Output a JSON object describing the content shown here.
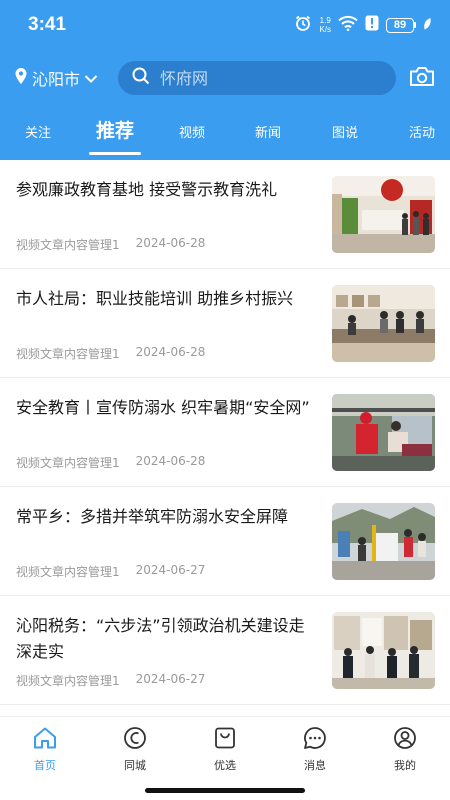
{
  "status_bar": {
    "time": "3:41",
    "net_speed_value": "1.9",
    "net_speed_unit": "K/s",
    "battery": "89",
    "icons": [
      "alarm-icon",
      "wifi-icon",
      "alert-icon",
      "battery-icon",
      "leaf-icon"
    ]
  },
  "header": {
    "city": "沁阳市",
    "search_placeholder": "怀府网",
    "camera_icon": "camera-icon",
    "background_color": "#3a9df0"
  },
  "tabs": [
    {
      "label": "关注"
    },
    {
      "label": "推荐",
      "active": true
    },
    {
      "label": "视频"
    },
    {
      "label": "新闻"
    },
    {
      "label": "图说"
    },
    {
      "label": "活动"
    }
  ],
  "articles": [
    {
      "title": "参观廉政教育基地 接受警示教育洗礼",
      "source": "视频文章内容管理1",
      "date": "2024-06-28"
    },
    {
      "title": "市人社局：职业技能培训 助推乡村振兴",
      "source": "视频文章内容管理1",
      "date": "2024-06-28"
    },
    {
      "title": "安全教育丨宣传防溺水 织牢暑期“安全网”",
      "source": "视频文章内容管理1",
      "date": "2024-06-28"
    },
    {
      "title": "常平乡：多措并举筑牢防溺水安全屏障",
      "source": "视频文章内容管理1",
      "date": "2024-06-27"
    },
    {
      "title": "沁阳税务：“六步法”引领政治机关建设走深走实",
      "source": "视频文章内容管理1",
      "date": "2024-06-27"
    }
  ],
  "bottom_nav": [
    {
      "label": "首页",
      "icon": "home-icon",
      "active": true
    },
    {
      "label": "同城",
      "icon": "local-icon"
    },
    {
      "label": "优选",
      "icon": "shopping-bag-icon"
    },
    {
      "label": "消息",
      "icon": "message-icon"
    },
    {
      "label": "我的",
      "icon": "profile-icon"
    }
  ],
  "colors": {
    "accent": "#3a9df0",
    "title_text": "#1a1a1a",
    "meta_text": "#9a9a9a"
  }
}
